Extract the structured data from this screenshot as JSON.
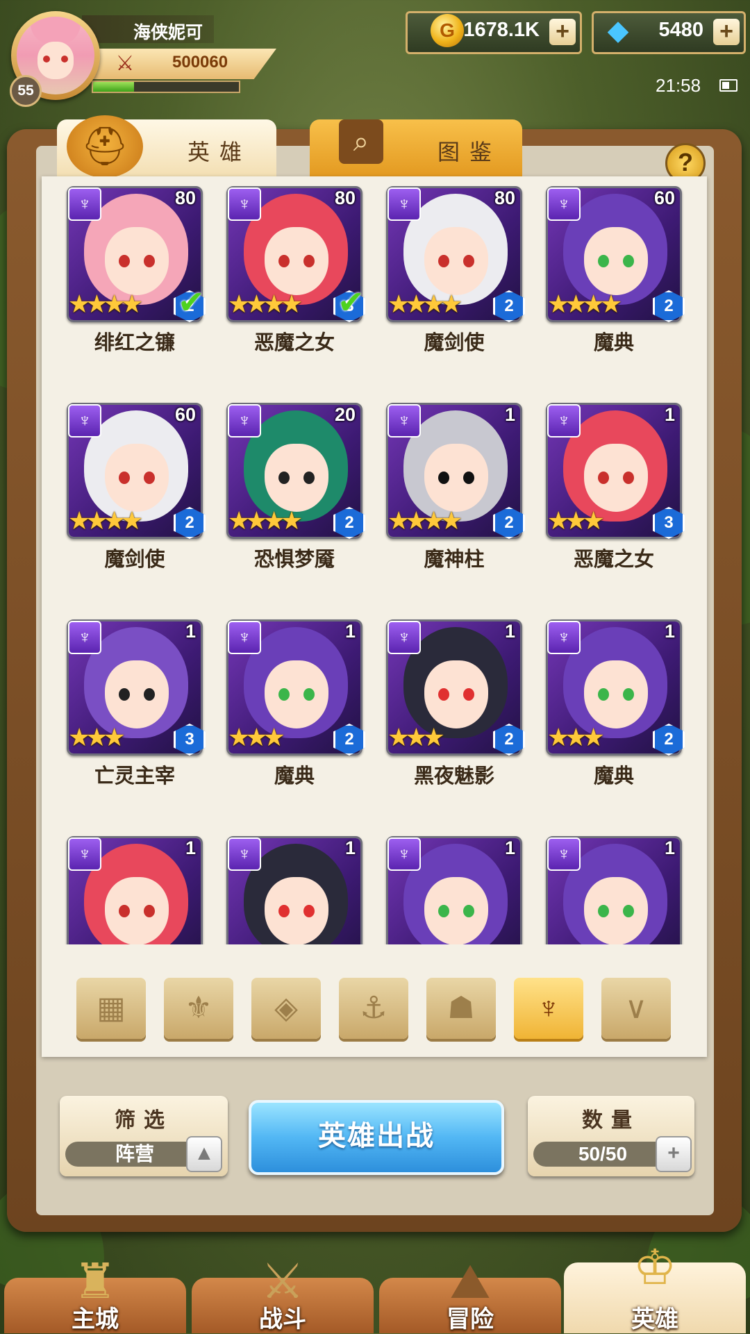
{
  "player": {
    "name": "海侠妮可",
    "level": "55",
    "power": "500060",
    "exp_fraction": 0.28
  },
  "currency": {
    "gold": "1678.1K",
    "gems": "5480",
    "plus": "+"
  },
  "status": {
    "time": "21:58"
  },
  "tabs": {
    "heroes": "英雄",
    "codex": "图鉴"
  },
  "help": "?",
  "heroes": [
    {
      "name": "绯红之镰",
      "level": "80",
      "tier": "2",
      "stars": 4,
      "checked": true,
      "hair": "#f5a6b8",
      "eyes": "#c9302c"
    },
    {
      "name": "恶魔之女",
      "level": "80",
      "tier": "3",
      "stars": 4,
      "checked": true,
      "hair": "#e8485c",
      "eyes": "#c9302c"
    },
    {
      "name": "魔剑使",
      "level": "80",
      "tier": "2",
      "stars": 4,
      "checked": false,
      "hair": "#ececf0",
      "eyes": "#c9302c"
    },
    {
      "name": "魔典",
      "level": "60",
      "tier": "2",
      "stars": 4,
      "checked": false,
      "hair": "#6a3fb8",
      "eyes": "#3bb54a"
    },
    {
      "name": "魔剑使",
      "level": "60",
      "tier": "2",
      "stars": 4,
      "checked": false,
      "hair": "#ececf0",
      "eyes": "#c9302c"
    },
    {
      "name": "恐惧梦魇",
      "level": "20",
      "tier": "2",
      "stars": 4,
      "checked": false,
      "hair": "#1e8a6a",
      "eyes": "#222222"
    },
    {
      "name": "魔神柱",
      "level": "1",
      "tier": "2",
      "stars": 4,
      "checked": false,
      "hair": "#c8c8d0",
      "eyes": "#111111"
    },
    {
      "name": "恶魔之女",
      "level": "1",
      "tier": "3",
      "stars": 3,
      "checked": false,
      "hair": "#e8485c",
      "eyes": "#c9302c"
    },
    {
      "name": "亡灵主宰",
      "level": "1",
      "tier": "3",
      "stars": 3,
      "checked": false,
      "hair": "#7a4fc4",
      "eyes": "#222222"
    },
    {
      "name": "魔典",
      "level": "1",
      "tier": "2",
      "stars": 3,
      "checked": false,
      "hair": "#6a3fb8",
      "eyes": "#3bb54a"
    },
    {
      "name": "黑夜魅影",
      "level": "1",
      "tier": "2",
      "stars": 3,
      "checked": false,
      "hair": "#2a2a3a",
      "eyes": "#e03030"
    },
    {
      "name": "魔典",
      "level": "1",
      "tier": "2",
      "stars": 3,
      "checked": false,
      "hair": "#6a3fb8",
      "eyes": "#3bb54a"
    },
    {
      "name": "",
      "level": "1",
      "tier": "",
      "stars": 0,
      "checked": false,
      "hair": "#e8485c",
      "eyes": "#c9302c"
    },
    {
      "name": "",
      "level": "1",
      "tier": "",
      "stars": 0,
      "checked": false,
      "hair": "#2a2a3a",
      "eyes": "#e03030"
    },
    {
      "name": "",
      "level": "1",
      "tier": "",
      "stars": 0,
      "checked": false,
      "hair": "#6a3fb8",
      "eyes": "#3bb54a"
    },
    {
      "name": "",
      "level": "1",
      "tier": "",
      "stars": 0,
      "checked": false,
      "hair": "#6a3fb8",
      "eyes": "#3bb54a"
    }
  ],
  "filters": [
    {
      "icon": "grid-icon",
      "glyph": "▦",
      "active": false
    },
    {
      "icon": "leaf-crown-icon",
      "glyph": "⚜",
      "active": false
    },
    {
      "icon": "rhombus-icon",
      "glyph": "◈",
      "active": false
    },
    {
      "icon": "anchor-icon",
      "glyph": "⚓",
      "active": false
    },
    {
      "icon": "beast-head-icon",
      "glyph": "☗",
      "active": false
    },
    {
      "icon": "demon-horns-icon",
      "glyph": "♆",
      "active": true
    },
    {
      "icon": "chevron-wing-icon",
      "glyph": "∨",
      "active": false
    }
  ],
  "controls": {
    "filter_title": "筛选",
    "filter_value": "阵营",
    "deploy": "英雄出战",
    "count_title": "数量",
    "count_value": "50/50"
  },
  "nav": [
    {
      "label": "主城",
      "icon": "castle-icon",
      "glyph": "♜",
      "active": false
    },
    {
      "label": "战斗",
      "icon": "crossed-swords-icon",
      "glyph": "⚔",
      "active": false
    },
    {
      "label": "冒险",
      "icon": "map-icon",
      "glyph": "⛰",
      "active": false
    },
    {
      "label": "英雄",
      "icon": "hero-emblem-icon",
      "glyph": "♔",
      "active": true
    }
  ],
  "colors": {
    "accent_gold": "#f0b435",
    "deploy_blue": "#52b7f4",
    "class_purple": "#7a3bd2",
    "tier_blue": "#1b6bd8"
  }
}
